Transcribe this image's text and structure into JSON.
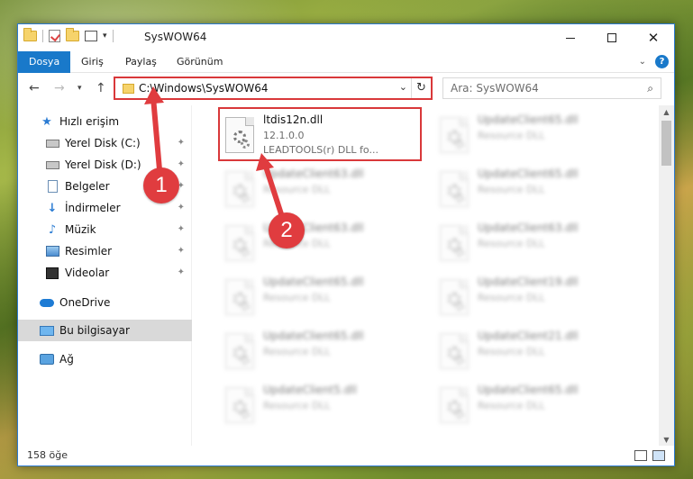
{
  "window": {
    "title": "SysWOW64"
  },
  "ribbon": {
    "tabs": [
      "Dosya",
      "Giriş",
      "Paylaş",
      "Görünüm"
    ]
  },
  "address": {
    "path": "C:\\Windows\\SysWOW64"
  },
  "search": {
    "placeholder": "Ara: SysWOW64"
  },
  "sidebar": {
    "items": [
      {
        "label": "Hızlı erişim",
        "icon": "star-icon"
      },
      {
        "label": "Yerel Disk (C:)",
        "icon": "drive-icon",
        "pinned": true
      },
      {
        "label": "Yerel Disk (D:)",
        "icon": "drive-icon",
        "pinned": true
      },
      {
        "label": "Belgeler",
        "icon": "documents-icon",
        "pinned": true
      },
      {
        "label": "İndirmeler",
        "icon": "downloads-icon",
        "pinned": true
      },
      {
        "label": "Müzik",
        "icon": "music-icon",
        "pinned": true
      },
      {
        "label": "Resimler",
        "icon": "pictures-icon",
        "pinned": true
      },
      {
        "label": "Videolar",
        "icon": "videos-icon",
        "pinned": true
      },
      {
        "label": "OneDrive",
        "icon": "onedrive-icon"
      },
      {
        "label": "Bu bilgisayar",
        "icon": "this-pc-icon",
        "selected": true
      },
      {
        "label": "Ağ",
        "icon": "network-icon"
      }
    ]
  },
  "files": {
    "highlighted": {
      "name": "ltdis12n.dll",
      "version": "12.1.0.0",
      "description": "LEADTOOLS(r) DLL fo..."
    },
    "left_column": [
      {
        "name": "UpdateClient63.dll",
        "type": "Resource DLL"
      },
      {
        "name": "UpdateClient63.dll",
        "type": "Resource DLL"
      },
      {
        "name": "UpdateClient65.dll",
        "type": "Resource DLL"
      },
      {
        "name": "UpdateClient65.dll",
        "type": "Resource DLL"
      },
      {
        "name": "UpdateClient5.dll",
        "type": "Resource DLL"
      }
    ],
    "right_column": [
      {
        "name": "UpdateClient65.dll",
        "type": "Resource DLL"
      },
      {
        "name": "UpdateClient65.dll",
        "type": "Resource DLL"
      },
      {
        "name": "UpdateClient63.dll",
        "type": "Resource DLL"
      },
      {
        "name": "UpdateClient19.dll",
        "type": "Resource DLL"
      },
      {
        "name": "UpdateClient21.dll",
        "type": "Resource DLL"
      },
      {
        "name": "UpdateClient65.dll",
        "type": "Resource DLL"
      }
    ]
  },
  "status": {
    "count": "158 öğe"
  },
  "callouts": [
    "1",
    "2"
  ],
  "colors": {
    "accent": "#1979ca",
    "highlight": "#d9383a",
    "callout": "#e03c3f"
  }
}
